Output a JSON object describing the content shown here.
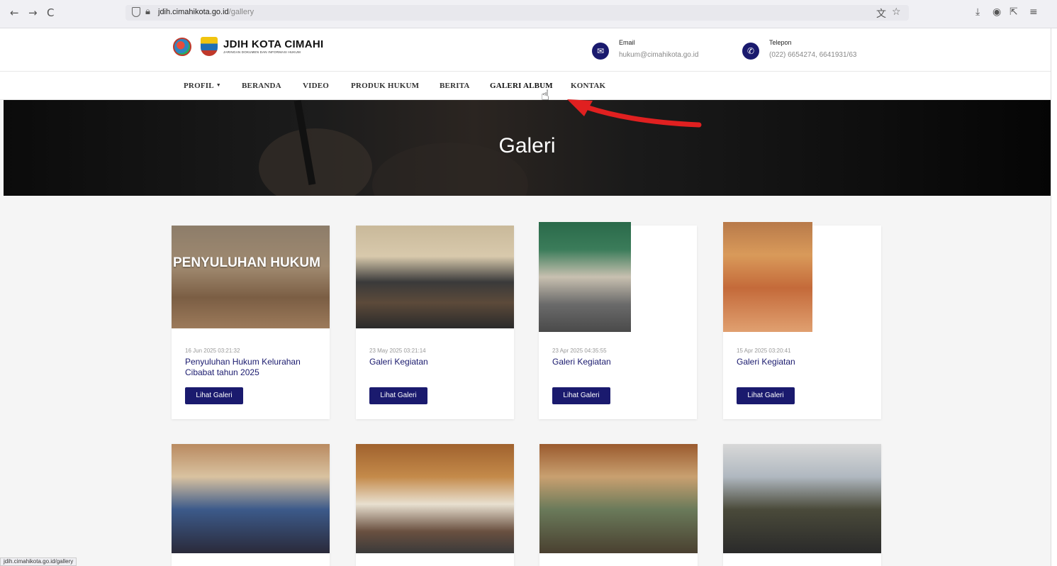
{
  "browser": {
    "back_icon": "←",
    "forward_icon": "→",
    "reload_icon": "C",
    "url_host": "jdih.cimahikota.go.id",
    "url_path": "/gallery",
    "status_url": "jdih.cimahikota.go.id/gallery"
  },
  "site": {
    "title": "JDIH KOTA CIMAHI",
    "subtitle": "JARINGAN DOKUMEN DAN INFORMASI HUKUM",
    "email_label": "Email",
    "email_value": "hukum@cimahikota.go.id",
    "phone_label": "Telepon",
    "phone_value": "(022) 6654274, 6641931/63"
  },
  "nav": {
    "items": [
      {
        "label": "PROFIL"
      },
      {
        "label": "BERANDA"
      },
      {
        "label": "VIDEO"
      },
      {
        "label": "PRODUK HUKUM"
      },
      {
        "label": "BERITA"
      },
      {
        "label": "GALERI ALBUM"
      },
      {
        "label": "KONTAK"
      }
    ]
  },
  "hero": {
    "title": "Galeri"
  },
  "cards": [
    {
      "date": "16 Jun 2025 03:21:32",
      "title": "Penyuluhan Hukum Kelurahan Cibabat tahun 2025",
      "button": "Lihat Galeri",
      "overlay": "PENYULUHAN HUKUM"
    },
    {
      "date": "23 May 2025 03:21:14",
      "title": "Galeri Kegiatan",
      "button": "Lihat Galeri"
    },
    {
      "date": "23 Apr 2025 04:35:55",
      "title": "Galeri Kegiatan",
      "button": "Lihat Galeri"
    },
    {
      "date": "15 Apr 2025 03:20:41",
      "title": "Galeri Kegiatan",
      "button": "Lihat Galeri"
    }
  ],
  "colors": {
    "brand_navy": "#1a1a6e",
    "annotation_red": "#e02020"
  }
}
